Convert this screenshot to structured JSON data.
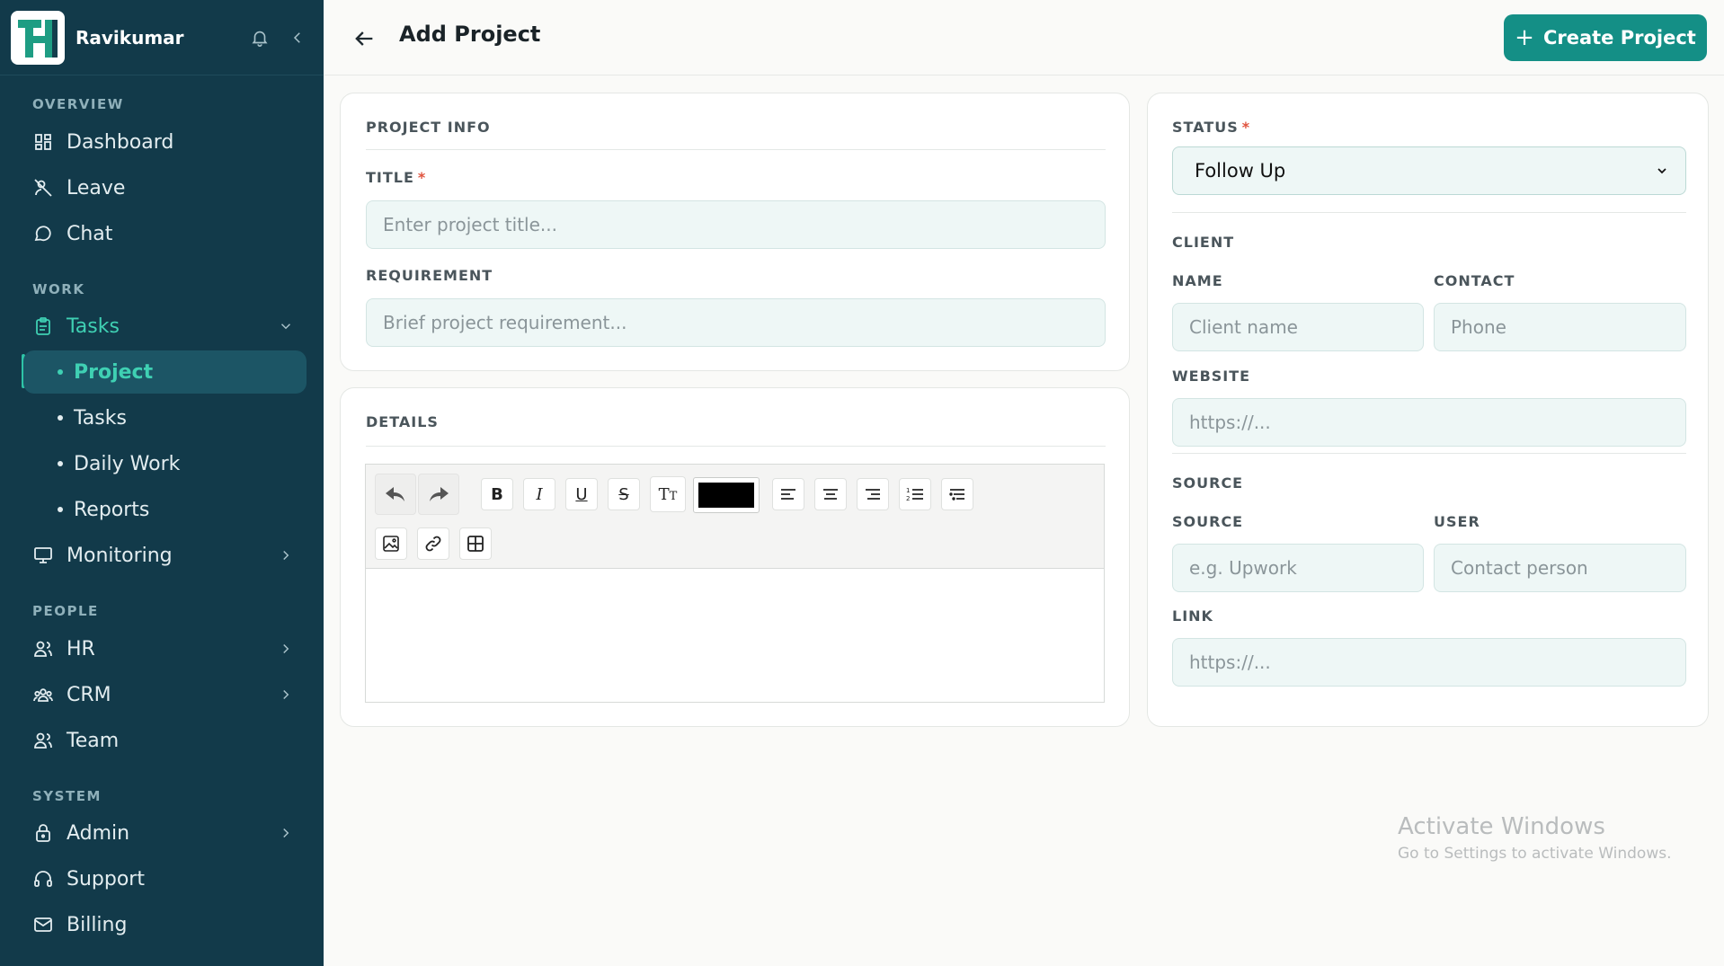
{
  "user": {
    "name": "Ravikumar"
  },
  "sidebar": {
    "sections": {
      "overview": "OVERVIEW",
      "work": "WORK",
      "people": "PEOPLE",
      "system": "SYSTEM"
    },
    "items": {
      "dashboard": "Dashboard",
      "leave": "Leave",
      "chat": "Chat",
      "tasks": "Tasks",
      "project": "Project",
      "tasks_sub": "Tasks",
      "daily_work": "Daily Work",
      "reports": "Reports",
      "monitoring": "Monitoring",
      "hr": "HR",
      "crm": "CRM",
      "team": "Team",
      "admin": "Admin",
      "support": "Support",
      "billing": "Billing"
    }
  },
  "header": {
    "title": "Add Project",
    "create_label": "Create Project"
  },
  "project_info": {
    "section_title": "PROJECT INFO",
    "title_label": "TITLE",
    "title_placeholder": "Enter project title...",
    "requirement_label": "REQUIREMENT",
    "requirement_placeholder": "Brief project requirement..."
  },
  "details": {
    "section_title": "DETAILS",
    "text_color": "#000000"
  },
  "status": {
    "label": "STATUS",
    "selected": "Follow Up"
  },
  "client": {
    "section_title": "CLIENT",
    "name_label": "NAME",
    "name_placeholder": "Client name",
    "contact_label": "CONTACT",
    "contact_placeholder": "Phone",
    "website_label": "WEBSITE",
    "website_placeholder": "https://..."
  },
  "source": {
    "section_title": "SOURCE",
    "source_label": "SOURCE",
    "source_placeholder": "e.g. Upwork",
    "user_label": "USER",
    "user_placeholder": "Contact person",
    "link_label": "LINK",
    "link_placeholder": "https://..."
  },
  "watermark": {
    "title": "Activate Windows",
    "subtitle": "Go to Settings to activate Windows."
  },
  "colors": {
    "sidebar_bg": "#123a4a",
    "accent": "#148f86",
    "active_text": "#3fd0b3"
  }
}
